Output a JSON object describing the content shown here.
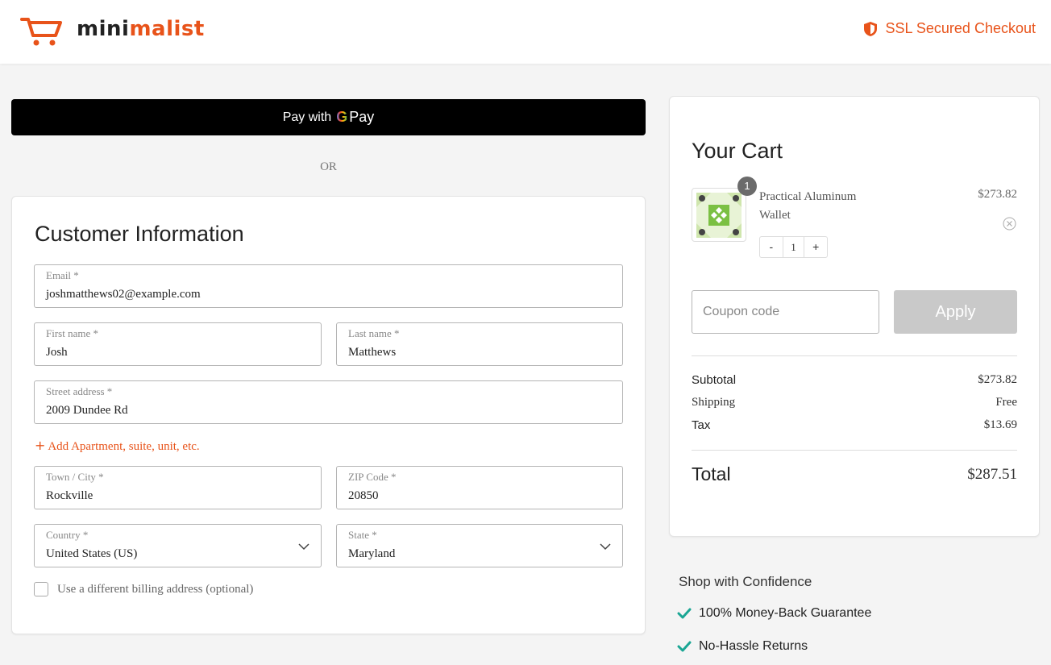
{
  "header": {
    "logo_part1": "mini",
    "logo_part2": "malist",
    "ssl_label": "SSL Secured Checkout",
    "accent_color": "#e8531a"
  },
  "payment": {
    "gpay_prefix": "Pay with",
    "gpay_g": "G",
    "gpay_suffix": "Pay",
    "or_label": "OR"
  },
  "customer": {
    "title": "Customer Information",
    "email": {
      "label": "Email *",
      "value": "joshmatthews02@example.com"
    },
    "first_name": {
      "label": "First name *",
      "value": "Josh"
    },
    "last_name": {
      "label": "Last name *",
      "value": "Matthews"
    },
    "street": {
      "label": "Street address *",
      "value": "2009 Dundee Rd"
    },
    "add_apartment": "Add Apartment, suite, unit, etc.",
    "city": {
      "label": "Town / City *",
      "value": "Rockville"
    },
    "zip": {
      "label": "ZIP Code *",
      "value": "20850"
    },
    "country": {
      "label": "Country *",
      "value": "United States (US)"
    },
    "state": {
      "label": "State *",
      "value": "Maryland"
    },
    "billing_label": "Use a different billing address (optional)"
  },
  "cart": {
    "title": "Your Cart",
    "items": [
      {
        "name": "Practical Aluminum Wallet",
        "price": "$273.82",
        "badge": "1",
        "quantity": "1",
        "minus": "-",
        "plus": "+"
      }
    ],
    "coupon_placeholder": "Coupon code",
    "apply_label": "Apply",
    "subtotal_label": "Subtotal",
    "subtotal_value": "$273.82",
    "shipping_label": "Shipping",
    "shipping_value": "Free",
    "tax_label": "Tax",
    "tax_value": "$13.69",
    "total_label": "Total",
    "total_value": "$287.51"
  },
  "confidence": {
    "title": "Shop with Confidence",
    "items": [
      "100% Money-Back Guarantee",
      "No-Hassle Returns"
    ],
    "check_color": "#1aa694"
  }
}
